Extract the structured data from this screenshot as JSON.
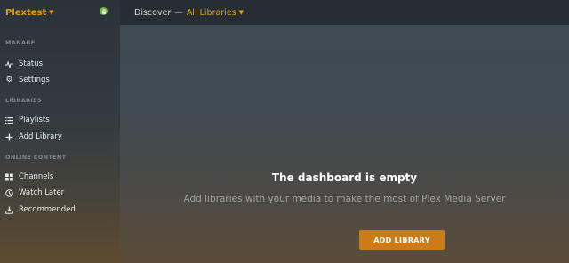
{
  "server": {
    "name": "Plextest",
    "caret_icon": "chevron-down-icon",
    "status_icon": "lock-icon",
    "status_color": "#6bbf3a"
  },
  "topbar": {
    "crumb_discover": "Discover",
    "separator": "—",
    "crumb_libraries": "All Libraries",
    "accent": "#e5a00d"
  },
  "sidebar": {
    "sections": {
      "manage": "MANAGE",
      "libraries": "LIBRARIES",
      "online": "ONLINE CONTENT"
    },
    "items": [
      {
        "label": "Status",
        "icon": "activity-icon"
      },
      {
        "label": "Settings",
        "icon": "gear-icon"
      },
      {
        "label": "Playlists",
        "icon": "list-icon"
      },
      {
        "label": "Add Library",
        "icon": "plus-icon"
      },
      {
        "label": "Channels",
        "icon": "grid-icon"
      },
      {
        "label": "Watch Later",
        "icon": "clock-icon"
      },
      {
        "label": "Recommended",
        "icon": "download-icon"
      }
    ]
  },
  "main": {
    "empty_title": "The dashboard is empty",
    "empty_subtitle": "Add libraries with your media to make the most of Plex Media Server",
    "add_button": "ADD LIBRARY",
    "button_color": "#cc7b19"
  }
}
